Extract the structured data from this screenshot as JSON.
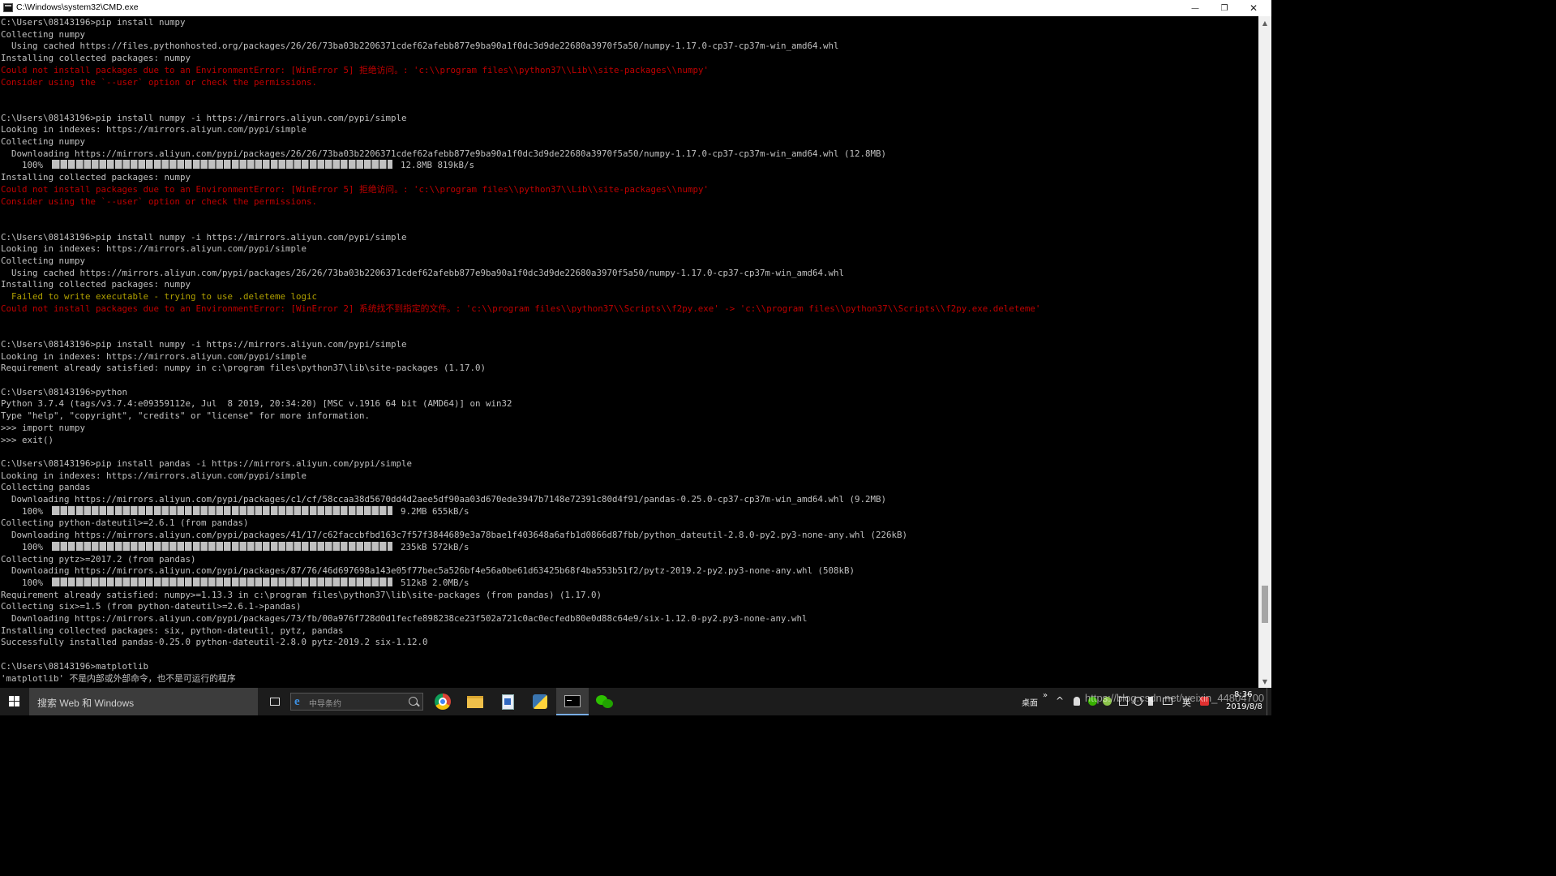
{
  "window": {
    "title": "C:\\Windows\\system32\\CMD.exe",
    "minimize_glyph": "—",
    "maximize_glyph": "❐",
    "close_glyph": "✕"
  },
  "console": {
    "lines": [
      {
        "text": "C:\\Users\\08143196>pip install numpy",
        "type": "normal"
      },
      {
        "text": "Collecting numpy",
        "type": "normal"
      },
      {
        "text": "  Using cached https://files.pythonhosted.org/packages/26/26/73ba03b2206371cdef62afebb877e9ba90a1f0dc3d9de22680a3970f5a50/numpy-1.17.0-cp37-cp37m-win_amd64.whl",
        "type": "normal"
      },
      {
        "text": "Installing collected packages: numpy",
        "type": "normal"
      },
      {
        "text": "Could not install packages due to an EnvironmentError: [WinError 5] 拒绝访问。: 'c:\\\\program files\\\\python37\\\\Lib\\\\site-packages\\\\numpy'",
        "type": "err"
      },
      {
        "text": "Consider using the `--user` option or check the permissions.",
        "type": "err"
      },
      {
        "text": "",
        "type": "normal"
      },
      {
        "text": "",
        "type": "normal"
      },
      {
        "text": "C:\\Users\\08143196>pip install numpy -i https://mirrors.aliyun.com/pypi/simple",
        "type": "normal"
      },
      {
        "text": "Looking in indexes: https://mirrors.aliyun.com/pypi/simple",
        "type": "normal"
      },
      {
        "text": "Collecting numpy",
        "type": "normal"
      },
      {
        "text": "  Downloading https://mirrors.aliyun.com/pypi/packages/26/26/73ba03b2206371cdef62afebb877e9ba90a1f0dc3d9de22680a3970f5a50/numpy-1.17.0-cp37-cp37m-win_amd64.whl (12.8MB)",
        "type": "normal"
      },
      {
        "pre": "    100% ",
        "post": " 12.8MB 819kB/s",
        "type": "progress",
        "progress": 1.0
      },
      {
        "text": "Installing collected packages: numpy",
        "type": "normal"
      },
      {
        "text": "Could not install packages due to an EnvironmentError: [WinError 5] 拒绝访问。: 'c:\\\\program files\\\\python37\\\\Lib\\\\site-packages\\\\numpy'",
        "type": "err"
      },
      {
        "text": "Consider using the `--user` option or check the permissions.",
        "type": "err"
      },
      {
        "text": "",
        "type": "normal"
      },
      {
        "text": "",
        "type": "normal"
      },
      {
        "text": "C:\\Users\\08143196>pip install numpy -i https://mirrors.aliyun.com/pypi/simple",
        "type": "normal"
      },
      {
        "text": "Looking in indexes: https://mirrors.aliyun.com/pypi/simple",
        "type": "normal"
      },
      {
        "text": "Collecting numpy",
        "type": "normal"
      },
      {
        "text": "  Using cached https://mirrors.aliyun.com/pypi/packages/26/26/73ba03b2206371cdef62afebb877e9ba90a1f0dc3d9de22680a3970f5a50/numpy-1.17.0-cp37-cp37m-win_amd64.whl",
        "type": "normal"
      },
      {
        "text": "Installing collected packages: numpy",
        "type": "normal"
      },
      {
        "text": "  Failed to write executable - trying to use .deleteme logic",
        "type": "warn"
      },
      {
        "text": "Could not install packages due to an EnvironmentError: [WinError 2] 系统找不到指定的文件。: 'c:\\\\program files\\\\python37\\\\Scripts\\\\f2py.exe' -> 'c:\\\\program files\\\\python37\\\\Scripts\\\\f2py.exe.deleteme'",
        "type": "err"
      },
      {
        "text": "",
        "type": "normal"
      },
      {
        "text": "",
        "type": "normal"
      },
      {
        "text": "C:\\Users\\08143196>pip install numpy -i https://mirrors.aliyun.com/pypi/simple",
        "type": "normal"
      },
      {
        "text": "Looking in indexes: https://mirrors.aliyun.com/pypi/simple",
        "type": "normal"
      },
      {
        "text": "Requirement already satisfied: numpy in c:\\program files\\python37\\lib\\site-packages (1.17.0)",
        "type": "normal"
      },
      {
        "text": "",
        "type": "normal"
      },
      {
        "text": "C:\\Users\\08143196>python",
        "type": "normal"
      },
      {
        "text": "Python 3.7.4 (tags/v3.7.4:e09359112e, Jul  8 2019, 20:34:20) [MSC v.1916 64 bit (AMD64)] on win32",
        "type": "normal"
      },
      {
        "text": "Type \"help\", \"copyright\", \"credits\" or \"license\" for more information.",
        "type": "normal"
      },
      {
        "text": ">>> import numpy",
        "type": "normal"
      },
      {
        "text": ">>> exit()",
        "type": "normal"
      },
      {
        "text": "",
        "type": "normal"
      },
      {
        "text": "C:\\Users\\08143196>pip install pandas -i https://mirrors.aliyun.com/pypi/simple",
        "type": "normal"
      },
      {
        "text": "Looking in indexes: https://mirrors.aliyun.com/pypi/simple",
        "type": "normal"
      },
      {
        "text": "Collecting pandas",
        "type": "normal"
      },
      {
        "text": "  Downloading https://mirrors.aliyun.com/pypi/packages/c1/cf/58ccaa38d5670dd4d2aee5df90aa03d670ede3947b7148e72391c80d4f91/pandas-0.25.0-cp37-cp37m-win_amd64.whl (9.2MB)",
        "type": "normal"
      },
      {
        "pre": "    100% ",
        "post": " 9.2MB 655kB/s",
        "type": "progress",
        "progress": 1.0
      },
      {
        "text": "Collecting python-dateutil>=2.6.1 (from pandas)",
        "type": "normal"
      },
      {
        "text": "  Downloading https://mirrors.aliyun.com/pypi/packages/41/17/c62faccbfbd163c7f57f3844689e3a78bae1f403648a6afb1d0866d87fbb/python_dateutil-2.8.0-py2.py3-none-any.whl (226kB)",
        "type": "normal"
      },
      {
        "pre": "    100% ",
        "post": " 235kB 572kB/s",
        "type": "progress",
        "progress": 1.0
      },
      {
        "text": "Collecting pytz>=2017.2 (from pandas)",
        "type": "normal"
      },
      {
        "text": "  Downloading https://mirrors.aliyun.com/pypi/packages/87/76/46d697698a143e05f77bec5a526bf4e56a0be61d63425b68f4ba553b51f2/pytz-2019.2-py2.py3-none-any.whl (508kB)",
        "type": "normal"
      },
      {
        "pre": "    100% ",
        "post": " 512kB 2.0MB/s",
        "type": "progress",
        "progress": 1.0
      },
      {
        "text": "Requirement already satisfied: numpy>=1.13.3 in c:\\program files\\python37\\lib\\site-packages (from pandas) (1.17.0)",
        "type": "normal"
      },
      {
        "text": "Collecting six>=1.5 (from python-dateutil>=2.6.1->pandas)",
        "type": "normal"
      },
      {
        "text": "  Downloading https://mirrors.aliyun.com/pypi/packages/73/fb/00a976f728d0d1fecfe898238ce23f502a721c0ac0ecfedb80e0d88c64e9/six-1.12.0-py2.py3-none-any.whl",
        "type": "normal"
      },
      {
        "text": "Installing collected packages: six, python-dateutil, pytz, pandas",
        "type": "normal"
      },
      {
        "text": "Successfully installed pandas-0.25.0 python-dateutil-2.8.0 pytz-2019.2 six-1.12.0",
        "type": "normal"
      },
      {
        "text": "",
        "type": "normal"
      },
      {
        "text": "C:\\Users\\08143196>matplotlib",
        "type": "normal"
      },
      {
        "text": "'matplotlib' 不是内部或外部命令，也不是可运行的程序",
        "type": "normal"
      }
    ]
  },
  "scrollbar": {
    "up_glyph": "▲",
    "down_glyph": "▼"
  },
  "taskbar": {
    "search_placeholder": "搜索 Web 和 Windows",
    "address_text": "中导条约",
    "apps": [
      {
        "name": "chrome",
        "icon": "chrome-icon"
      },
      {
        "name": "file-explorer",
        "icon": "folder-icon"
      },
      {
        "name": "document-app",
        "icon": "document-icon"
      },
      {
        "name": "python",
        "icon": "python-icon"
      },
      {
        "name": "cmd",
        "icon": "cmd-icon",
        "active": true
      },
      {
        "name": "wechat",
        "icon": "wechat-icon"
      }
    ],
    "tray": {
      "desktop_label": "桌面",
      "overflow_glyph": "»",
      "ime_label": "英",
      "time": "8:36",
      "date": "2019/8/8"
    },
    "watermark": "https://blog.csdn.net/weixin_44804700"
  },
  "colors": {
    "console_bg": "#000000",
    "console_text": "#c0c0c0",
    "error_text": "#c00000",
    "warning_text": "#b0a000",
    "taskbar_bg": "#1c1c1c"
  }
}
